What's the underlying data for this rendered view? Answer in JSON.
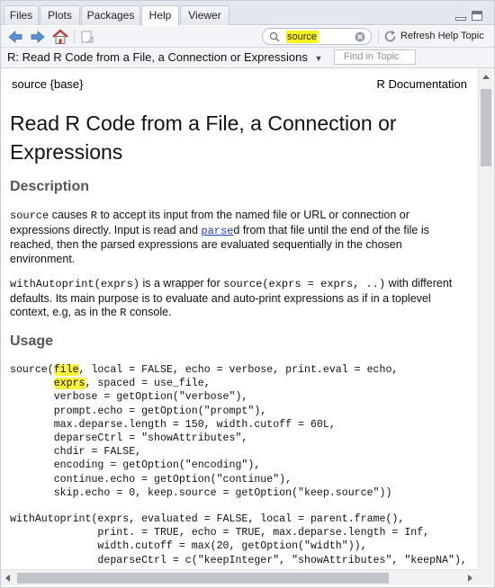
{
  "tabs": [
    {
      "label": "Files"
    },
    {
      "label": "Plots"
    },
    {
      "label": "Packages"
    },
    {
      "label": "Help"
    },
    {
      "label": "Viewer"
    }
  ],
  "toolbar": {
    "search_value": "source",
    "refresh_label": "Refresh Help Topic"
  },
  "topic_bar": {
    "title": "R: Read R Code from a File, a Connection or Expressions",
    "find_placeholder": "Find in Topic"
  },
  "doc": {
    "header_left": "source {base}",
    "header_right": "R Documentation",
    "title": "Read R Code from a File, a Connection or Expressions",
    "description_heading": "Description",
    "desc1": {
      "code_source": "source",
      "t1": " causes ",
      "code_r": "R",
      "t2": " to accept its input from the named file or URL or connection or expressions directly. Input is read and ",
      "link_parse": "parse",
      "t3": "d from that file until the end of the file is reached, then the parsed expressions are evaluated sequentially in the chosen environment."
    },
    "desc2": {
      "code_wa": "withAutoprint(exprs)",
      "t1": " is a wrapper for ",
      "code_src": "source(exprs = exprs, ..)",
      "t2": " with different defaults. Its main purpose is to evaluate and auto-print expressions as if in a toplevel context, e.g, as in the ",
      "code_r": "R",
      "t3": " console."
    },
    "usage_heading": "Usage",
    "usage_source": {
      "pre1": "source(",
      "hl1": "file",
      "post1": ", local = FALSE, echo = verbose, print.eval = echo,",
      "indent2": "       ",
      "hl2": "exprs",
      "post2": ", spaced = use_file,",
      "rest": "       verbose = getOption(\"verbose\"),\n       prompt.echo = getOption(\"prompt\"),\n       max.deparse.length = 150, width.cutoff = 60L,\n       deparseCtrl = \"showAttributes\",\n       chdir = FALSE,\n       encoding = getOption(\"encoding\"),\n       continue.echo = getOption(\"continue\"),\n       skip.echo = 0, keep.source = getOption(\"keep.source\"))"
    },
    "usage_autoprint": "withAutoprint(exprs, evaluated = FALSE, local = parent.frame(),\n              print. = TRUE, echo = TRUE, max.deparse.length = Inf,\n              width.cutoff = max(20, getOption(\"width\")),\n              deparseCtrl = c(\"keepInteger\", \"showAttributes\", \"keepNA\"),"
  },
  "colors": {
    "highlight": "#fbf23a",
    "link": "#1f3fbf",
    "heading": "#555555"
  },
  "icons": [
    "back-arrow-icon",
    "forward-arrow-icon",
    "home-icon",
    "print-icon",
    "search-icon",
    "clear-search-icon",
    "refresh-icon",
    "dropdown-caret-icon",
    "minimize-icon",
    "maximize-icon"
  ]
}
